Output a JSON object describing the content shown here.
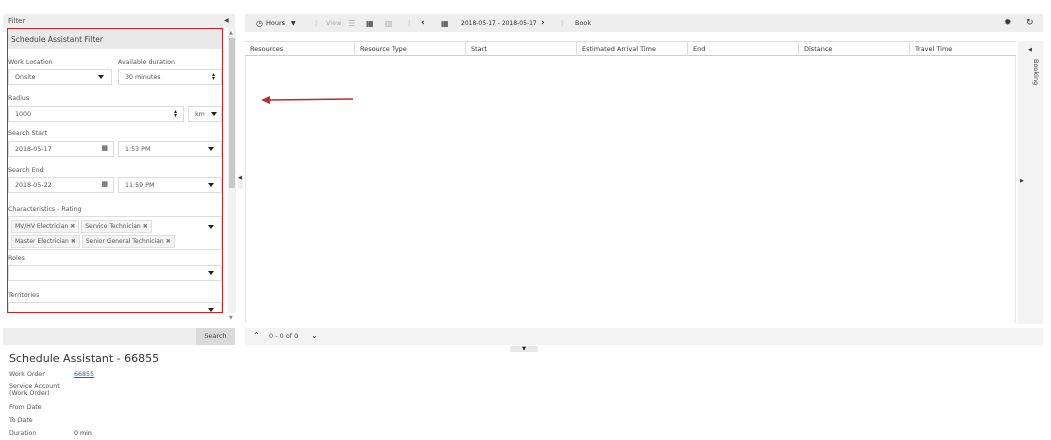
{
  "filter": {
    "header": "Filter",
    "collapse_icon": "chevron-left",
    "panel_title": "Schedule Assistant Filter",
    "work_location": {
      "label": "Work Location",
      "value": "Onsite"
    },
    "available_duration": {
      "label": "Available duration",
      "value": "30 minutes"
    },
    "radius": {
      "label": "Radius",
      "value": "1000",
      "unit": "km"
    },
    "search_start": {
      "label": "Search Start",
      "date": "2018-05-17",
      "time": "1:53 PM"
    },
    "search_end": {
      "label": "Search End",
      "date": "2018-05-22",
      "time": "11:59 PM"
    },
    "characteristics": {
      "label": "Characteristics - Rating",
      "chips": [
        "MV/HV Electrician",
        "Service Technician",
        "Master Electrician",
        "Senior General Technician"
      ]
    },
    "roles": {
      "label": "Roles",
      "value": ""
    },
    "territories": {
      "label": "Territories",
      "value": ""
    },
    "search_button": "Search"
  },
  "details": {
    "title": "Schedule Assistant - 66855",
    "rows": [
      {
        "label": "Work Order",
        "value": "66855"
      },
      {
        "label": "Service Account (Work Order)",
        "value": ""
      },
      {
        "label": "From Date",
        "value": ""
      },
      {
        "label": "To Date",
        "value": ""
      },
      {
        "label": "Duration",
        "value": "0 min"
      }
    ]
  },
  "toolbar": {
    "hours_label": "Hours",
    "view_label": "View",
    "date_range": "2018-05-17 - 2018-05-17",
    "book_label": "Book"
  },
  "grid": {
    "columns": [
      "Resources",
      "Resource Type",
      "Start",
      "Estimated Arrival Time",
      "End",
      "Distance",
      "Travel Time"
    ]
  },
  "pager": {
    "text": "0 - 0 of 0"
  },
  "booking_panel": {
    "label": "Booking"
  },
  "colors": {
    "highlight_border": "#d02020",
    "arrow": "#c0282a"
  }
}
